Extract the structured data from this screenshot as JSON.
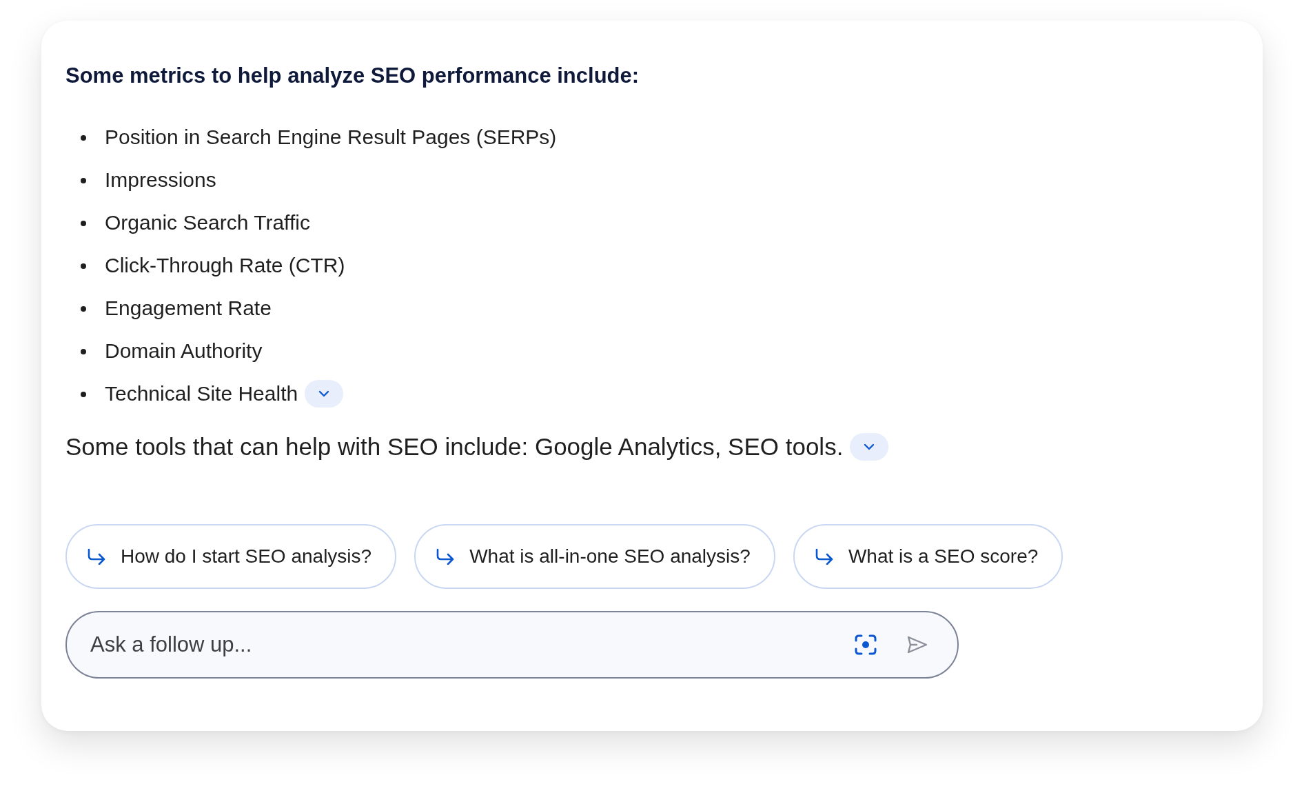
{
  "answer": {
    "heading": "Some metrics to help analyze SEO performance include:",
    "metrics": [
      {
        "text": "Position in Search Engine Result Pages (SERPs)",
        "expand_button": false
      },
      {
        "text": "Impressions",
        "expand_button": false
      },
      {
        "text": "Organic Search Traffic",
        "expand_button": false
      },
      {
        "text": "Click-Through Rate (CTR)",
        "expand_button": false
      },
      {
        "text": "Engagement Rate",
        "expand_button": false
      },
      {
        "text": "Domain Authority",
        "expand_button": false
      },
      {
        "text": "Technical Site Health",
        "expand_button": true
      }
    ],
    "tools": {
      "text": "Some tools that can help with SEO include: Google Analytics, SEO tools.",
      "expand_button": true
    }
  },
  "suggestions": [
    "How do I start SEO analysis?",
    "What is all-in-one SEO analysis?",
    "What is a SEO score?"
  ],
  "follow_up": {
    "placeholder": "Ask a follow up..."
  }
}
